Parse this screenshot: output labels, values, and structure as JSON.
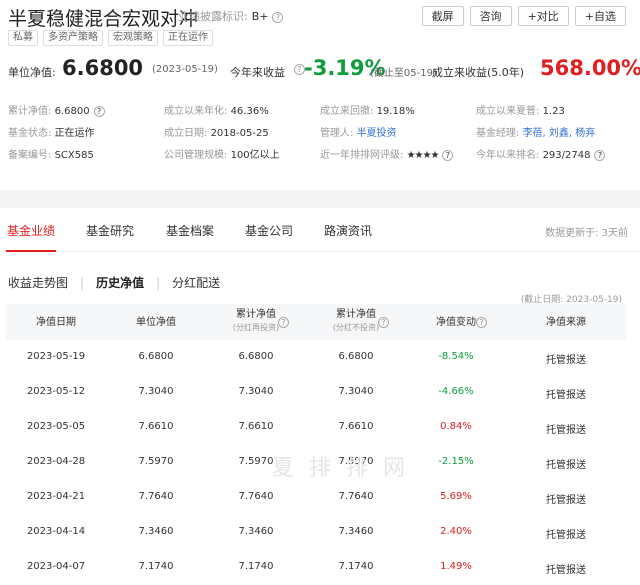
{
  "header": {
    "fund_name": "半夏稳健混合宏观对冲",
    "disclosure_label": "业绩披露标识:",
    "disclosure_value": "B+",
    "buttons": [
      "截屏",
      "咨询",
      "+对比",
      "+自选"
    ],
    "tags": [
      "私募",
      "多资产策略",
      "宏观策略",
      "正在运作"
    ]
  },
  "nav": {
    "unit_nav_label": "单位净值:",
    "unit_nav_value": "6.6800",
    "unit_nav_date": "(2023-05-19)",
    "ytd_label": "今年来收益",
    "ytd_value": "-3.19%",
    "ytd_note": "(截止至05-19)",
    "since_inception_label": "成立来收益(5.0年)",
    "since_inception_value": "568.00%"
  },
  "info": {
    "cum_nav_label": "累计净值:",
    "cum_nav_value": "6.6800",
    "annual_label": "成立以来年化:",
    "annual_value": "46.36%",
    "drawdown_label": "成立来回撤:",
    "drawdown_value": "19.18%",
    "sharpe_label": "成立以来夏普:",
    "sharpe_value": "1.23",
    "status_label": "基金状态:",
    "status_value": "正在运作",
    "inception_label": "成立日期:",
    "inception_value": "2018-05-25",
    "manager_co_label": "管理人:",
    "manager_co_value": "半夏投资",
    "managers_label": "基金经理:",
    "managers_value": "李蓓, 刘鑫, 杨弃",
    "record_label": "备案编号:",
    "record_value": "SCX585",
    "scale_label": "公司管理规模:",
    "scale_value": "100亿以上",
    "rating_label": "近一年排排网评级:",
    "rating_stars": "★★★★",
    "rank_label": "今年以来排名:",
    "rank_value": "293/2748"
  },
  "tabs": [
    "基金业绩",
    "基金研究",
    "基金档案",
    "基金公司",
    "路演资讯"
  ],
  "update_note": "数据更新于: 3天前",
  "subtabs": [
    "收益走势图",
    "历史净值",
    "分红配送"
  ],
  "as_of": "(截止日期: 2023-05-19)",
  "table": {
    "headers": {
      "date": "净值日期",
      "unit": "单位净值",
      "cum_reinvest": "累计净值",
      "cum_reinvest_sub": "(分红再投资)",
      "cum_no_reinvest": "累计净值",
      "cum_no_reinvest_sub": "(分红不投资)",
      "change": "净值变动",
      "source": "净值来源"
    },
    "rows": [
      {
        "date": "2023-05-19",
        "unit": "6.6800",
        "cum1": "6.6800",
        "cum2": "6.6800",
        "change": "-8.54%",
        "source": "托管报送"
      },
      {
        "date": "2023-05-12",
        "unit": "7.3040",
        "cum1": "7.3040",
        "cum2": "7.3040",
        "change": "-4.66%",
        "source": "托管报送"
      },
      {
        "date": "2023-05-05",
        "unit": "7.6610",
        "cum1": "7.6610",
        "cum2": "7.6610",
        "change": "0.84%",
        "source": "托管报送"
      },
      {
        "date": "2023-04-28",
        "unit": "7.5970",
        "cum1": "7.5970",
        "cum2": "7.5970",
        "change": "-2.15%",
        "source": "托管报送"
      },
      {
        "date": "2023-04-21",
        "unit": "7.7640",
        "cum1": "7.7640",
        "cum2": "7.7640",
        "change": "5.69%",
        "source": "托管报送"
      },
      {
        "date": "2023-04-14",
        "unit": "7.3460",
        "cum1": "7.3460",
        "cum2": "7.3460",
        "change": "2.40%",
        "source": "托管报送"
      },
      {
        "date": "2023-04-07",
        "unit": "7.1740",
        "cum1": "7.1740",
        "cum2": "7.1740",
        "change": "1.49%",
        "source": "托管报送"
      }
    ]
  },
  "watermark": "夏 排 排 网",
  "colors": {
    "accent": "#e02020",
    "up": "#e02020",
    "down": "#0d9d3b",
    "link": "#3371d8"
  }
}
